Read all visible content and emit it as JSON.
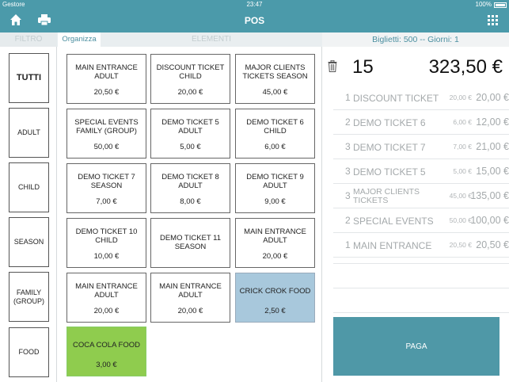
{
  "status_bar": {
    "carrier": "Gestore",
    "time": "23:47",
    "battery": "100%"
  },
  "header": {
    "title": "POS",
    "icons": {
      "home": "home-icon",
      "printer": "printer-icon",
      "apps": "grid-icon"
    }
  },
  "tabs": {
    "filter": "FILTRO",
    "organize": "Organizza",
    "elements": "ELEMENTI"
  },
  "summary": "Biglietti: 500 -- Giorni: 1",
  "filters": [
    "TUTTI",
    "ADULT",
    "CHILD",
    "SEASON",
    "FAMILY (GROUP)",
    "FOOD"
  ],
  "items": [
    {
      "name": "MAIN ENTRANCE ADULT",
      "price": "20,50 €",
      "color": "#ffffff"
    },
    {
      "name": "DISCOUNT TICKET CHILD",
      "price": "20,00 €",
      "color": "#ffffff"
    },
    {
      "name": "MAJOR CLIENTS TICKETS SEASON",
      "price": "45,00 €",
      "color": "#ffffff"
    },
    {
      "name": "SPECIAL EVENTS FAMILY (GROUP)",
      "price": "50,00 €",
      "color": "#ffffff"
    },
    {
      "name": "DEMO TICKET 5 ADULT",
      "price": "5,00 €",
      "color": "#ffffff"
    },
    {
      "name": "DEMO TICKET 6 CHILD",
      "price": "6,00 €",
      "color": "#ffffff"
    },
    {
      "name": "DEMO TICKET 7 SEASON",
      "price": "7,00 €",
      "color": "#ffffff"
    },
    {
      "name": "DEMO TICKET 8 ADULT",
      "price": "8,00 €",
      "color": "#ffffff"
    },
    {
      "name": "DEMO TICKET 9 ADULT",
      "price": "9,00 €",
      "color": "#ffffff"
    },
    {
      "name": "DEMO TICKET 10 CHILD",
      "price": "10,00 €",
      "color": "#ffffff"
    },
    {
      "name": "DEMO TICKET 11 SEASON",
      "price": "",
      "color": "#ffffff"
    },
    {
      "name": "MAIN ENTRANCE ADULT",
      "price": "20,00 €",
      "color": "#ffffff"
    },
    {
      "name": "MAIN ENTRANCE ADULT",
      "price": "20,00 €",
      "color": "#ffffff"
    },
    {
      "name": "MAIN ENTRANCE ADULT",
      "price": "20,00 €",
      "color": "#ffffff"
    },
    {
      "name": "CRICK CROK FOOD",
      "price": "2,50 €",
      "color": "#a8c8dc"
    },
    {
      "name": "COCA COLA FOOD",
      "price": "3,00 €",
      "color": "#8fcc4e"
    }
  ],
  "cart": {
    "quantity": "15",
    "total": "323,50 €",
    "lines": [
      {
        "qty": "1",
        "name": "DISCOUNT TICKET",
        "unit_price": "20,00 €",
        "line_total": "20,00 €"
      },
      {
        "qty": "2",
        "name": "DEMO TICKET 6",
        "unit_price": "6,00 €",
        "line_total": "12,00 €"
      },
      {
        "qty": "3",
        "name": "DEMO TICKET 7",
        "unit_price": "7,00 €",
        "line_total": "21,00 €"
      },
      {
        "qty": "3",
        "name": "DEMO TICKET 5",
        "unit_price": "5,00 €",
        "line_total": "15,00 €"
      },
      {
        "qty": "3",
        "name": "MAJOR CLIENTS TICKETS",
        "unit_price": "45,00 €",
        "line_total": "135,00 €"
      },
      {
        "qty": "2",
        "name": "SPECIAL EVENTS",
        "unit_price": "50,00 €",
        "line_total": "100,00 €"
      },
      {
        "qty": "1",
        "name": "MAIN ENTRANCE",
        "unit_price": "20,50 €",
        "line_total": "20,50 €"
      }
    ]
  },
  "pay_label": "PAGA",
  "colors": {
    "accent": "#4b9aaa",
    "pay": "#4f98a7",
    "organize_text": "#4b8fa0"
  }
}
